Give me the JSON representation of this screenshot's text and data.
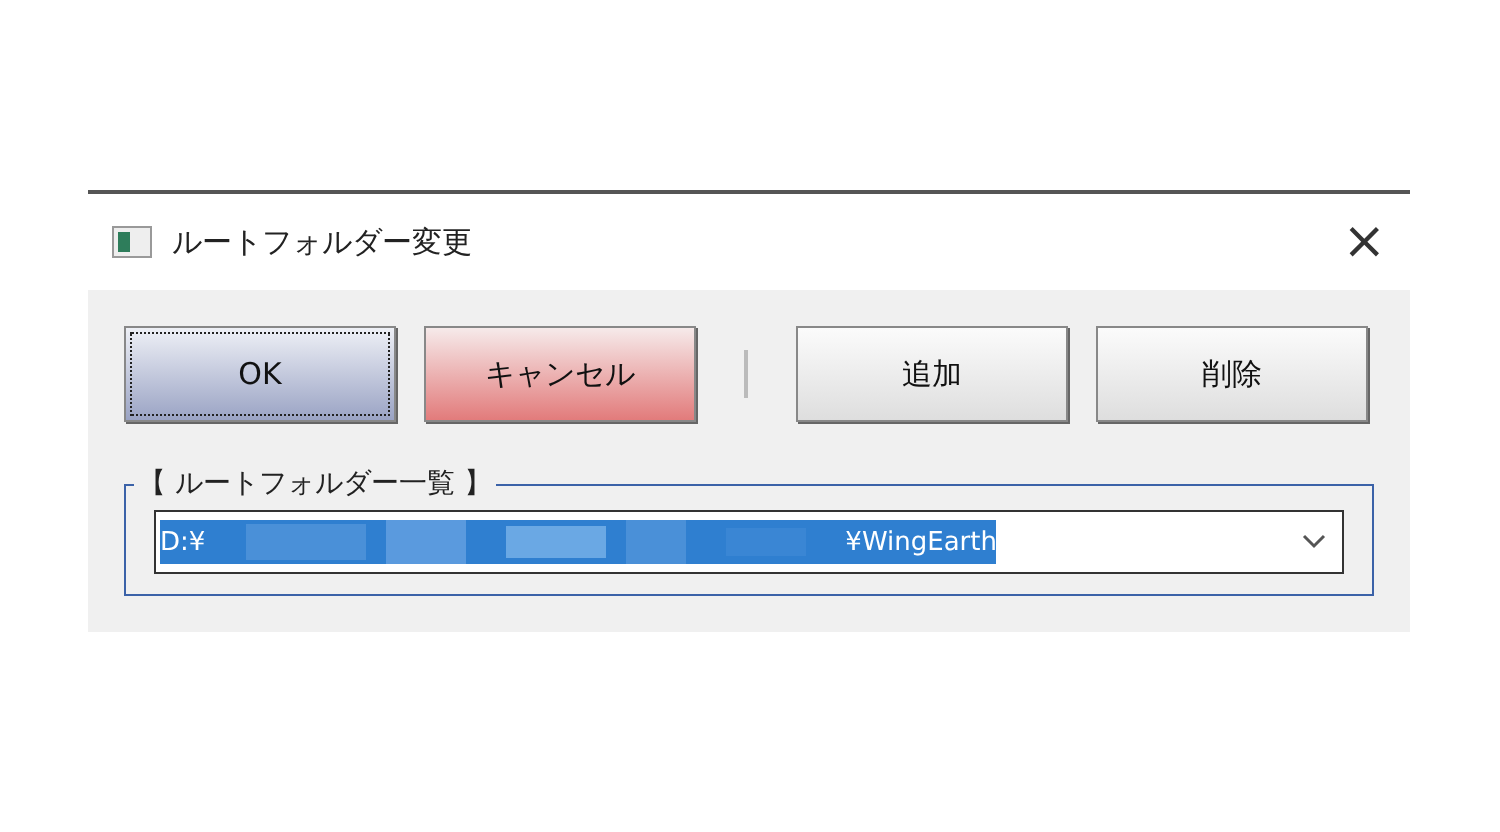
{
  "window": {
    "title": "ルートフォルダー変更",
    "close": "×"
  },
  "buttons": [
    {
      "label": "OK",
      "kind": "ok",
      "focused": true
    },
    {
      "label": "キャンセル",
      "kind": "cancel",
      "focused": false
    },
    {
      "label": "追加",
      "kind": "plain",
      "focused": false
    },
    {
      "label": "削除",
      "kind": "plain",
      "focused": false
    }
  ],
  "group": {
    "title": "【 ルートフォルダー一覧 】",
    "combo": {
      "value_start": "D:¥",
      "value_end": "¥WingEarth",
      "selected": true
    }
  }
}
